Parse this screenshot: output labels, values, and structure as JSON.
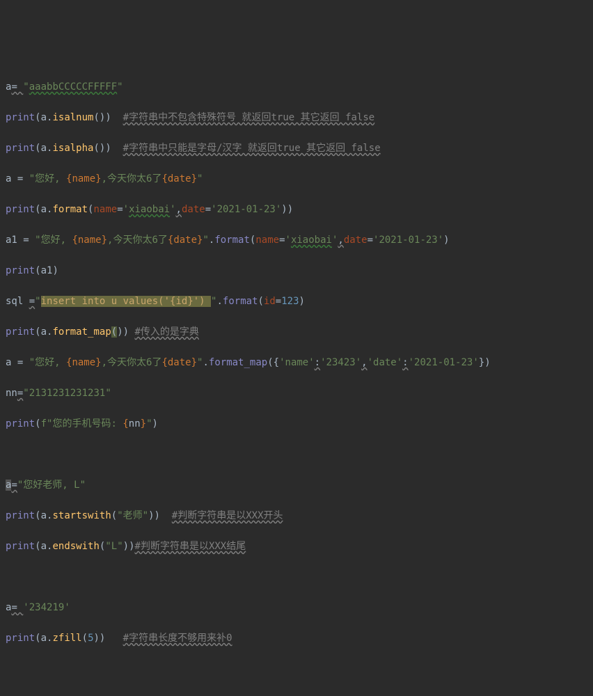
{
  "l1": {
    "var": "a",
    "eq": "= ",
    "q1": "\"",
    "s": "aaabbCCCCCFFFFF",
    "q2": "\""
  },
  "l2": {
    "print": "print",
    "p1": "(",
    "a": "a",
    "dot": ".",
    "fn": "isalnum",
    "call": "())  ",
    "c": "#字符串中不包含特殊符号 就返回true 其它返回 false"
  },
  "l3": {
    "print": "print",
    "p1": "(",
    "a": "a",
    "dot": ".",
    "fn": "isalpha",
    "call": "())  ",
    "c": "#字符串中只能是字母/汉字 就返回true 其它返回 false"
  },
  "l4": {
    "a": "a ",
    "eq": "= ",
    "q1": "\"",
    "s1": "您好, ",
    "br1": "{name}",
    "s2": ",今天你太6了",
    "br2": "{date}",
    "q2": "\""
  },
  "l5": {
    "print": "print",
    "p1": "(",
    "a": "a",
    "dot": ".",
    "fn": "format",
    "p2": "(",
    "k1": "name",
    "eqk": "=",
    "v1q1": "'",
    "v1": "xiaobai",
    "v1q2": "'",
    "cm": ",",
    "k2": "date",
    "v2q1": "'",
    "v2": "2021-01-23",
    "v2q2": "'",
    "close": "))"
  },
  "l6": {
    "a1": "a1 ",
    "eq": "= ",
    "q1": "\"",
    "s1": "您好, ",
    "br1": "{name}",
    "s2": ",今天你太6了",
    "br2": "{date}",
    "q2": "\"",
    "dot": ".",
    "fn": "format",
    "p2": "(",
    "k1": "name",
    "eqk": "=",
    "v1q1": "'",
    "v1": "xiaobai",
    "v1q2": "'",
    "cm": ",",
    "k2": "date",
    "v2q1": "'",
    "v2": "2021-01-23",
    "v2q2": "'",
    "close": ")"
  },
  "l7": {
    "print": "print",
    "p1": "(",
    "a1": "a1",
    "close": ")"
  },
  "l8": {
    "sql": "sql ",
    "eq": "=",
    "q1": "\"",
    "seg1": "insert into u values('",
    "br": "{id}",
    "seg2": "') ",
    "q2": "\"",
    "dot": ".",
    "fn": "format",
    "p2": "(",
    "k": "id",
    "eqk": "=",
    "v": "123",
    "close": ")"
  },
  "l9": {
    "print": "print",
    "p1": "(",
    "a": "a",
    "dot": ".",
    "fn": "format_map",
    "p2": "(",
    "close": ")) ",
    "c": "#传入的是字典"
  },
  "l10": {
    "a": "a ",
    "eq": "= ",
    "q1": "\"",
    "s1": "您好, ",
    "br1": "{name}",
    "s2": ",今天你太6了",
    "br2": "{date}",
    "q2": "\"",
    "dot": ".",
    "fn": "format_map",
    "p2": "(",
    "ob": "{",
    "k1q1": "'",
    "k1": "name",
    "k1q2": "'",
    "col": ":",
    "v1q1": "'",
    "v1": "23423",
    "v1q2": "'",
    "cm": ",",
    "k2q1": "'",
    "k2": "date",
    "k2q2": "'",
    "v2q1": "'",
    "v2": "2021-01-23",
    "v2q2": "'",
    "cb": "}",
    "close": ")"
  },
  "l11": {
    "nn": "nn",
    "eq": "=",
    "q1": "\"",
    "s": "2131231231231",
    "q2": "\""
  },
  "l12": {
    "print": "print",
    "p1": "(",
    "f": "f",
    "q1": "\"",
    "s1": "您的手机号码: ",
    "br1o": "{",
    "br1v": "nn",
    "br1c": "}",
    "q2": "\"",
    "close": ")"
  },
  "l13": {
    "a": "a",
    "eq": "=",
    "q1": "\"",
    "s": "您好老师, L",
    "q2": "\""
  },
  "l14": {
    "print": "print",
    "p1": "(",
    "a": "a",
    "dot": ".",
    "fn": "startswith",
    "p2": "(",
    "q1": "\"",
    "arg": "老师",
    "q2": "\"",
    "close": "))  ",
    "c": "#判断字符串是以XXX开头"
  },
  "l15": {
    "print": "print",
    "p1": "(",
    "a": "a",
    "dot": ".",
    "fn": "endswith",
    "p2": "(",
    "q1": "\"",
    "arg": "L",
    "q2": "\"",
    "close": "))",
    "c": "#判断字符串是以XXX结尾"
  },
  "l16": {
    "a": "a",
    "eq": "= ",
    "q1": "'",
    "s": "234219",
    "q2": "'"
  },
  "l17": {
    "print": "print",
    "p1": "(",
    "a": "a",
    "dot": ".",
    "fn": "zfill",
    "p2": "(",
    "arg": "5",
    "close": "))   ",
    "c": "#字符串长度不够用来补0"
  }
}
